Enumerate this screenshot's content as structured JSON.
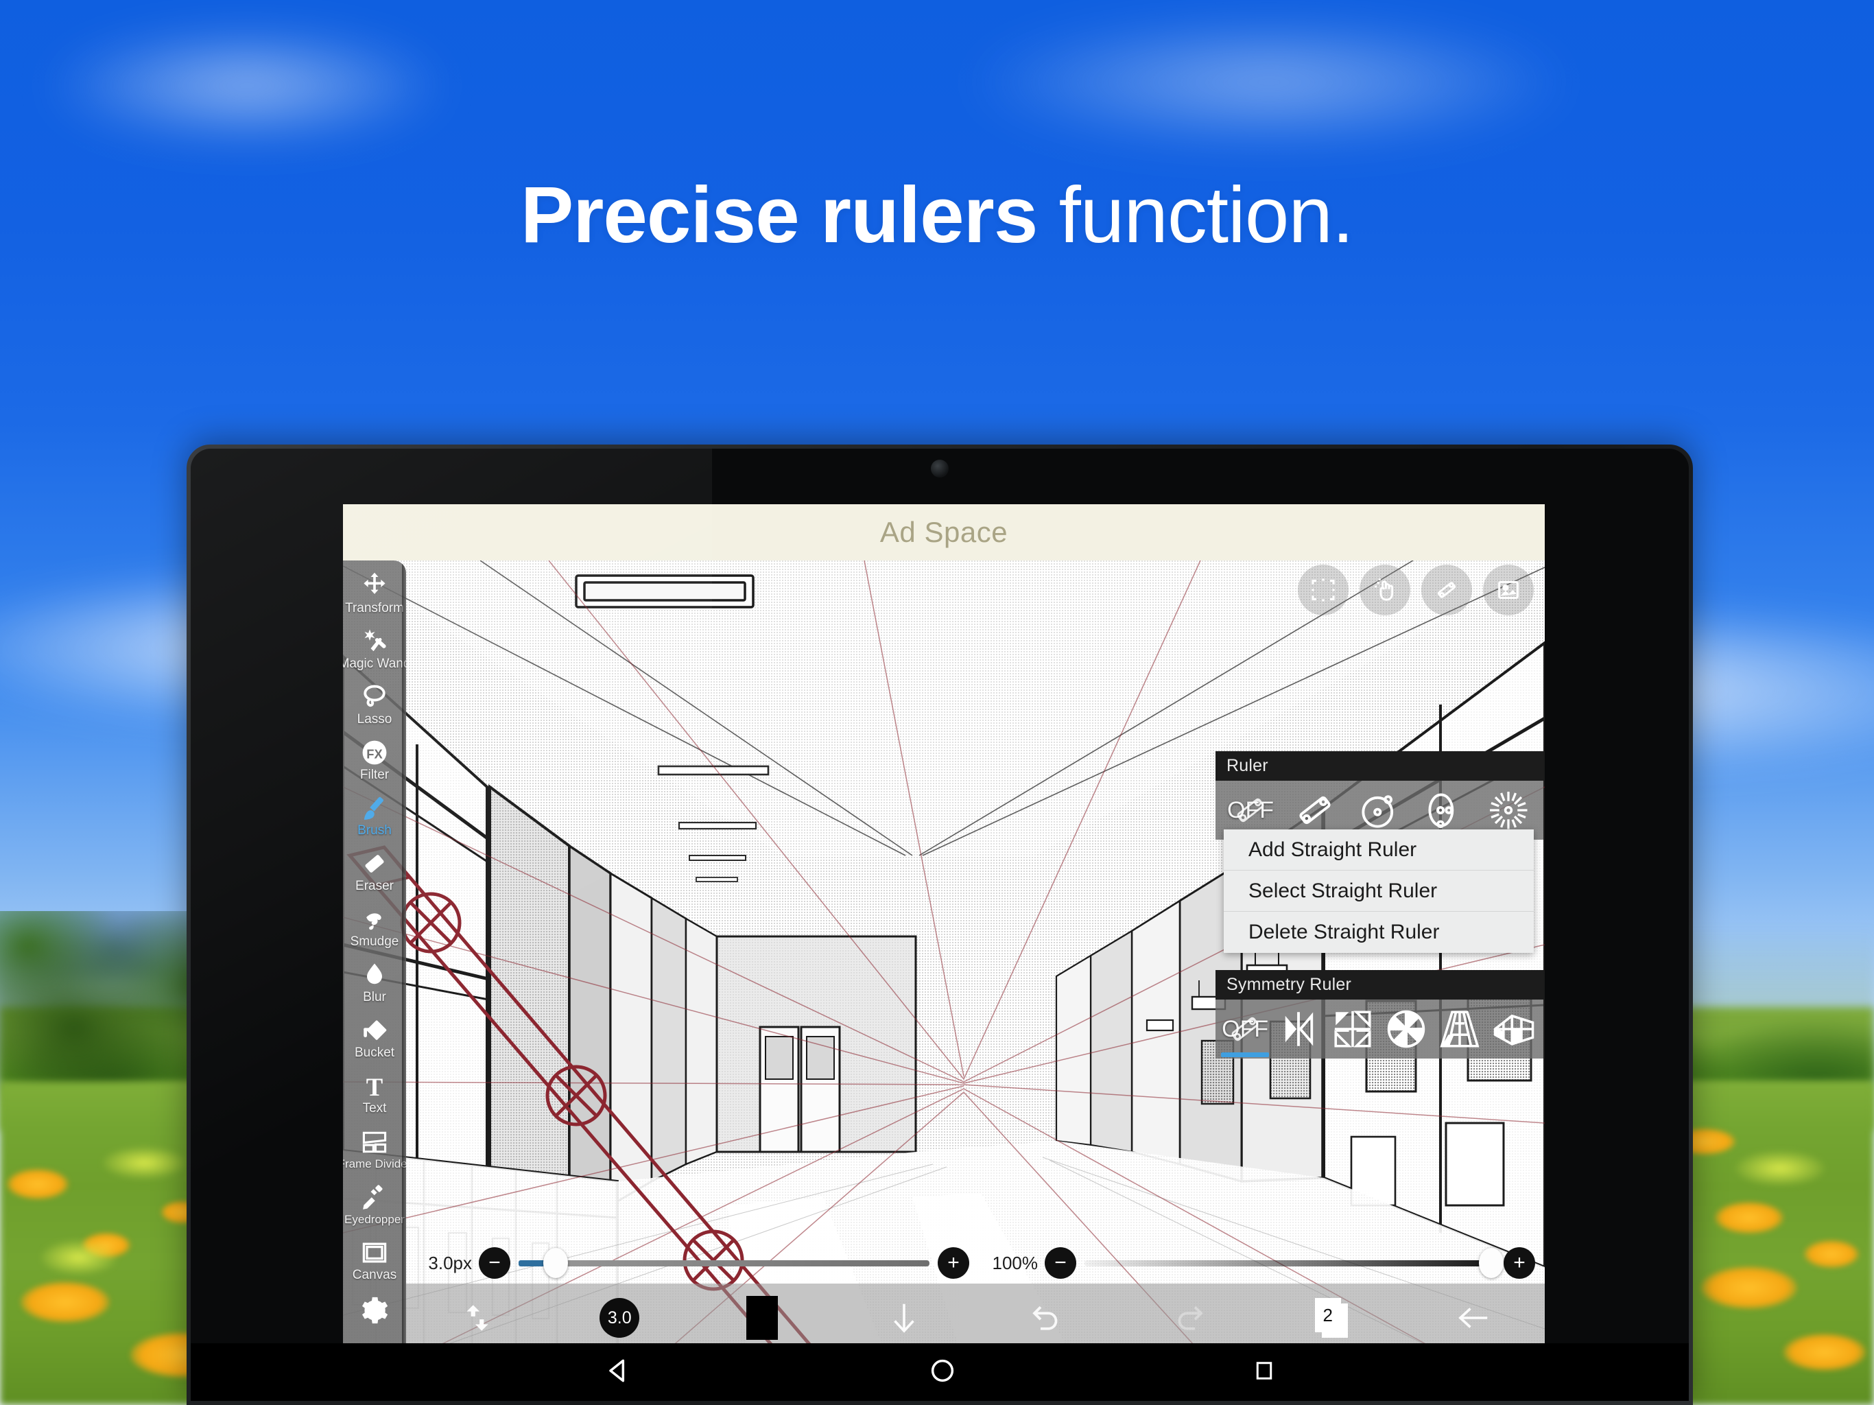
{
  "headline": {
    "bold": "Precise rulers",
    "light": " function."
  },
  "app": {
    "ad_banner": "Ad Space",
    "top_icons": [
      {
        "name": "selection-frame-icon",
        "label": "Selection"
      },
      {
        "name": "gesture-hand-icon",
        "label": "Gesture"
      },
      {
        "name": "straight-ruler-icon",
        "label": "Ruler"
      },
      {
        "name": "image-icon",
        "label": "Image"
      }
    ],
    "toolbar": {
      "items": [
        {
          "label": "Transform",
          "icon": "move-arrows-icon",
          "active": false
        },
        {
          "label": "Magic Wand",
          "icon": "magic-wand-icon",
          "active": false
        },
        {
          "label": "Lasso",
          "icon": "lasso-icon",
          "active": false
        },
        {
          "label": "Filter",
          "icon": "fx-icon",
          "active": false
        },
        {
          "label": "Brush",
          "icon": "brush-icon",
          "active": true
        },
        {
          "label": "Eraser",
          "icon": "eraser-icon",
          "active": false
        },
        {
          "label": "Smudge",
          "icon": "smudge-finger-icon",
          "active": false
        },
        {
          "label": "Blur",
          "icon": "water-drop-icon",
          "active": false
        },
        {
          "label": "Bucket",
          "icon": "paint-bucket-icon",
          "active": false
        },
        {
          "label": "Text",
          "icon": "text-t-icon",
          "active": false
        },
        {
          "label": "Frame Divider",
          "icon": "frame-divider-icon",
          "active": false
        },
        {
          "label": "Eyedropper",
          "icon": "eyedropper-icon",
          "active": false
        },
        {
          "label": "Canvas",
          "icon": "canvas-square-icon",
          "active": false
        }
      ],
      "settings_icon": "gear-icon"
    },
    "ruler_panel": {
      "title": "Ruler",
      "off_label": "OFF",
      "options": [
        {
          "name": "ruler-off",
          "label": "OFF",
          "selected": false
        },
        {
          "name": "straight-ruler",
          "label": "Straight Ruler",
          "selected": true
        },
        {
          "name": "circle-ruler",
          "label": "Circle Ruler",
          "selected": false
        },
        {
          "name": "ellipse-ruler",
          "label": "Ellipse Ruler",
          "selected": false
        },
        {
          "name": "radial-ruler",
          "label": "Radial Ruler",
          "selected": false
        }
      ],
      "menu": [
        "Add Straight Ruler",
        "Select Straight Ruler",
        "Delete Straight Ruler"
      ]
    },
    "symmetry_panel": {
      "title": "Symmetry Ruler",
      "off_label": "OFF",
      "options": [
        {
          "name": "symmetry-off",
          "label": "OFF",
          "selected": true
        },
        {
          "name": "mirror-symmetry",
          "label": "Mirror",
          "selected": false
        },
        {
          "name": "quad-symmetry",
          "label": "Quad Mirror",
          "selected": false
        },
        {
          "name": "radial-symmetry",
          "label": "Radial",
          "selected": false
        },
        {
          "name": "one-point-perspective",
          "label": "1-Point Perspective",
          "selected": false
        },
        {
          "name": "two-point-perspective",
          "label": "2-Point Perspective",
          "selected": false
        }
      ]
    },
    "sliders": {
      "brush_size_value": "3.0px",
      "brush_size_percent": 9,
      "opacity_value": "100%",
      "opacity_percent": 100,
      "minus_label": "−",
      "plus_label": "+"
    },
    "bottom_bar": {
      "flip_icon": "flip-icon",
      "brush_size_badge": "3.0",
      "color_swatch": "#000000",
      "down_arrow_icon": "arrow-down-icon",
      "undo_icon": "undo-icon",
      "redo_icon": "redo-icon",
      "layers_count": "2",
      "back_icon": "arrow-left-icon"
    },
    "accent_color": "#3f9fe0"
  },
  "android_nav": {
    "back": "nav-back-icon",
    "home": "nav-home-icon",
    "recents": "nav-recents-icon"
  }
}
